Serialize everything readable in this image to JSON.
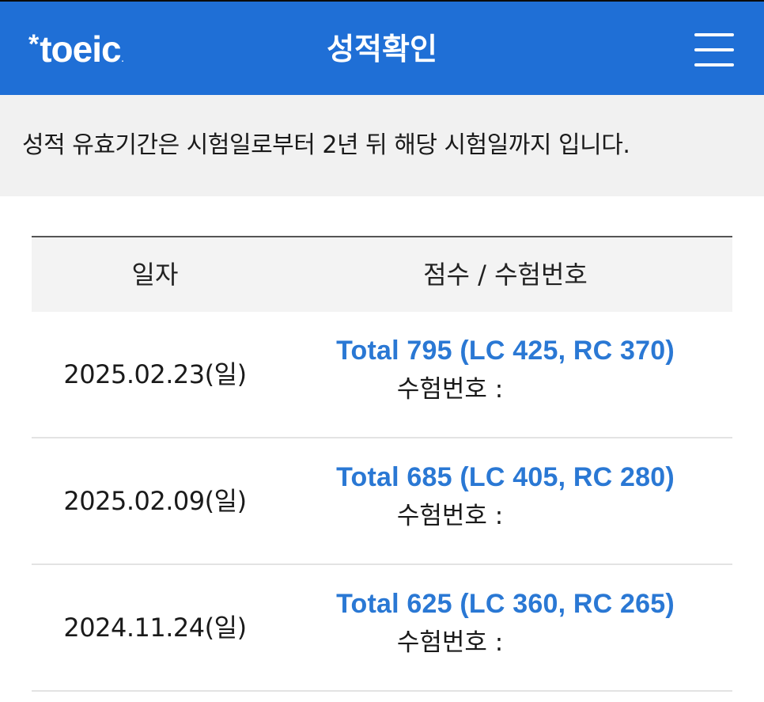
{
  "header": {
    "logo_star": "*",
    "logo_text": "toeic",
    "logo_dot": ".",
    "title": "성적확인"
  },
  "notice": {
    "text": "성적 유효기간은 시험일로부터 2년 뒤 해당 시험일까지 입니다."
  },
  "table": {
    "columns": {
      "date": "일자",
      "score": "점수 / 수험번호"
    },
    "rows": [
      {
        "date": "2025.02.23(일)",
        "score": "Total 795 (LC 425, RC 370)",
        "exam_label": "수험번호 :"
      },
      {
        "date": "2025.02.09(일)",
        "score": "Total 685 (LC 405, RC 280)",
        "exam_label": "수험번호 :"
      },
      {
        "date": "2024.11.24(일)",
        "score": "Total 625 (LC 360, RC 265)",
        "exam_label": "수험번호 :"
      }
    ]
  },
  "colors": {
    "header_bg": "#1f6fd6",
    "score_link": "#2a78d4",
    "notice_bg": "#f1f1f1",
    "table_head_bg": "#f3f3f3"
  },
  "icons": {
    "menu": "hamburger-menu-icon",
    "logo": "toeic-asterisk-logo"
  }
}
